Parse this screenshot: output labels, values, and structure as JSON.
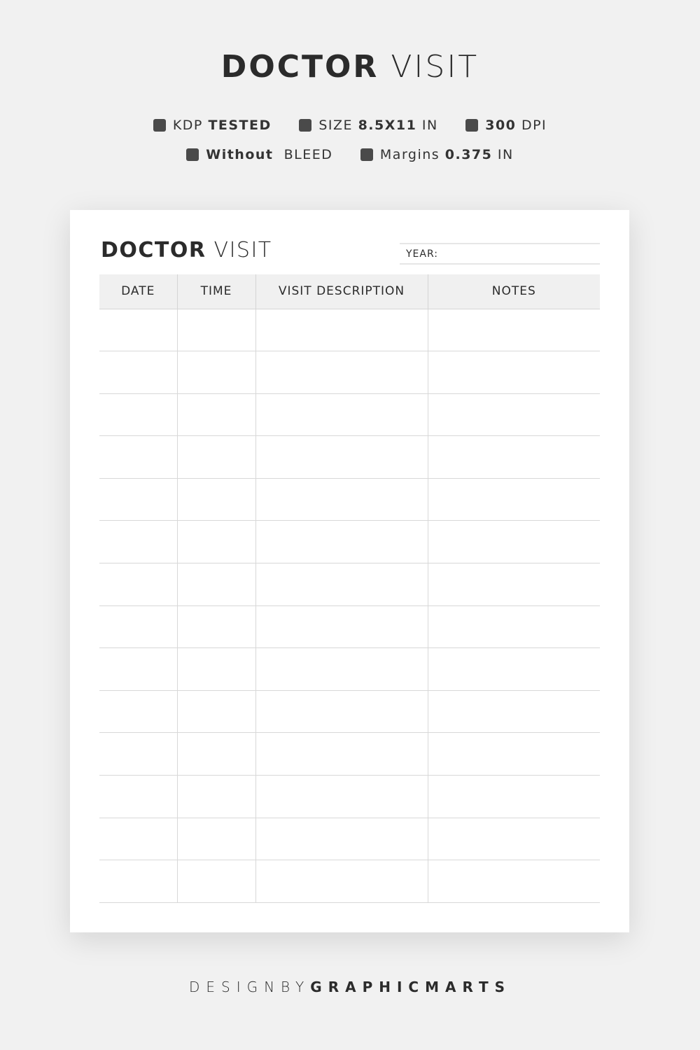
{
  "title": {
    "bold": "DOCTOR",
    "light": "VISIT"
  },
  "features": [
    [
      {
        "a": "KDP",
        "b": "TESTED",
        "bold": "b"
      },
      {
        "a": "SIZE",
        "b": "8.5X11",
        "c": "IN"
      },
      {
        "a": "300",
        "b": "DPI",
        "bold": "a"
      }
    ],
    [
      {
        "a": "Without",
        "b": "BLEED",
        "bold": "a"
      },
      {
        "a": "Margins",
        "b": "0.375",
        "c": "IN"
      }
    ]
  ],
  "page": {
    "title_bold": "DOCTOR",
    "title_light": "VISIT",
    "year_label": "YEAR:",
    "columns": [
      "DATE",
      "TIME",
      "VISIT DESCRIPTION",
      "NOTES"
    ],
    "row_count": 14
  },
  "footer": {
    "light": "DESIGNBY",
    "bold": "GRAPHICMARTS"
  }
}
